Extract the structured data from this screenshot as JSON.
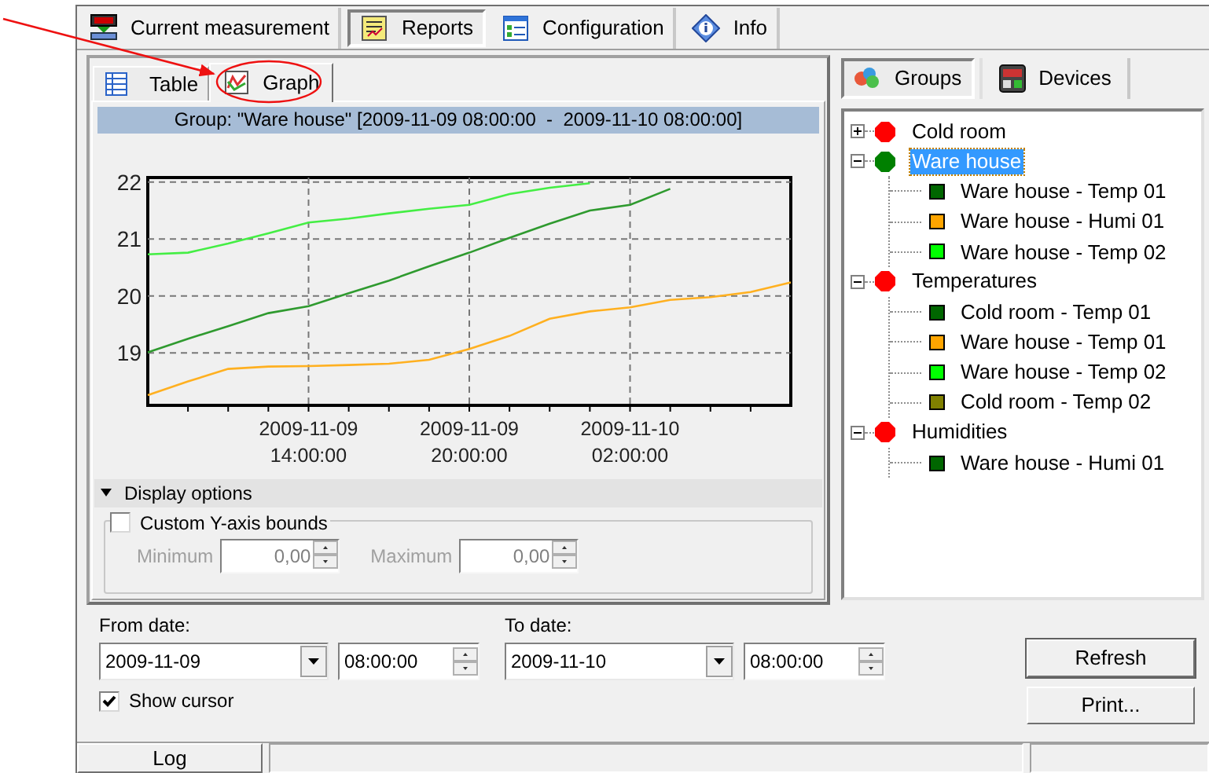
{
  "tabs": [
    {
      "label": "Current measurement",
      "selected": false
    },
    {
      "label": "Reports",
      "selected": true
    },
    {
      "label": "Configuration",
      "selected": false
    },
    {
      "label": "Info",
      "selected": false
    }
  ],
  "report_tabs": [
    {
      "label": "Table",
      "selected": false
    },
    {
      "label": "Graph",
      "selected": true
    }
  ],
  "graph": {
    "title": "Group: \"Ware house\" [2009-11-09 08:00:00  -  2009-11-10 08:00:00]",
    "chart_data": {
      "type": "line",
      "grid": true,
      "ylim": [
        18.08,
        22.08
      ],
      "yticks": [
        19,
        20,
        21,
        22
      ],
      "categories": [
        null,
        null,
        null,
        null,
        "2009-11-09 14:00:00",
        null,
        null,
        null,
        "2009-11-09 20:00:00",
        null,
        null,
        null,
        "2009-11-10 02:00:00",
        null,
        null,
        null,
        null
      ],
      "series": [
        {
          "color": "#44ee44",
          "values": [
            20.73,
            20.76,
            20.92,
            21.1,
            21.29,
            21.36,
            21.45,
            21.53,
            21.6,
            21.79,
            21.9,
            21.98,
            null,
            null,
            null,
            null,
            null
          ]
        },
        {
          "color": "#2f9a2f",
          "values": [
            19.01,
            19.25,
            19.47,
            19.7,
            19.82,
            20.05,
            20.27,
            20.52,
            20.76,
            21.02,
            21.27,
            21.5,
            21.6,
            21.88,
            null,
            null,
            null
          ]
        },
        {
          "color": "#ffb020",
          "values": [
            18.26,
            18.5,
            18.72,
            18.76,
            18.77,
            18.79,
            18.81,
            18.88,
            19.07,
            19.3,
            19.6,
            19.73,
            19.8,
            19.93,
            19.98,
            20.07,
            20.24
          ]
        }
      ]
    }
  },
  "display_options": {
    "label": "Display options",
    "expanded": true,
    "custom_bounds": {
      "label": "Custom Y-axis bounds",
      "checked": false
    },
    "minimum": {
      "label": "Minimum",
      "value": "0,00",
      "disabled": true
    },
    "maximum": {
      "label": "Maximum",
      "value": "0,00",
      "disabled": true
    }
  },
  "from_date": {
    "label": "From date:",
    "date": "2009-11-09",
    "time": "08:00:00"
  },
  "to_date": {
    "label": "To date:",
    "date": "2009-11-10",
    "time": "08:00:00"
  },
  "show_cursor": {
    "label": "Show cursor",
    "checked": true
  },
  "side_tabs": [
    {
      "label": "Groups",
      "selected": true
    },
    {
      "label": "Devices",
      "selected": false
    }
  ],
  "tree": [
    {
      "label": "Cold room",
      "color": "#ff0000",
      "expanded": false,
      "selected": false
    },
    {
      "label": "Ware house",
      "color": "#008000",
      "expanded": true,
      "selected": true,
      "children": [
        {
          "label": "Ware house - Temp 01",
          "color": "#006600"
        },
        {
          "label": "Ware house - Humi 01",
          "color": "#ffa500"
        },
        {
          "label": "Ware house - Temp 02",
          "color": "#00ff00"
        }
      ]
    },
    {
      "label": "Temperatures",
      "color": "#ff0000",
      "expanded": true,
      "selected": false,
      "children": [
        {
          "label": "Cold room - Temp 01",
          "color": "#006600"
        },
        {
          "label": "Ware house - Temp 01",
          "color": "#ffa500"
        },
        {
          "label": "Ware house - Temp 02",
          "color": "#00ff00"
        },
        {
          "label": "Cold room - Temp 02",
          "color": "#808000"
        }
      ]
    },
    {
      "label": "Humidities",
      "color": "#ff0000",
      "expanded": true,
      "selected": false,
      "children": [
        {
          "label": "Ware house - Humi 01",
          "color": "#006600"
        }
      ]
    }
  ],
  "buttons": [
    "Refresh",
    "Print..."
  ],
  "status_bar": {
    "log": "Log"
  }
}
